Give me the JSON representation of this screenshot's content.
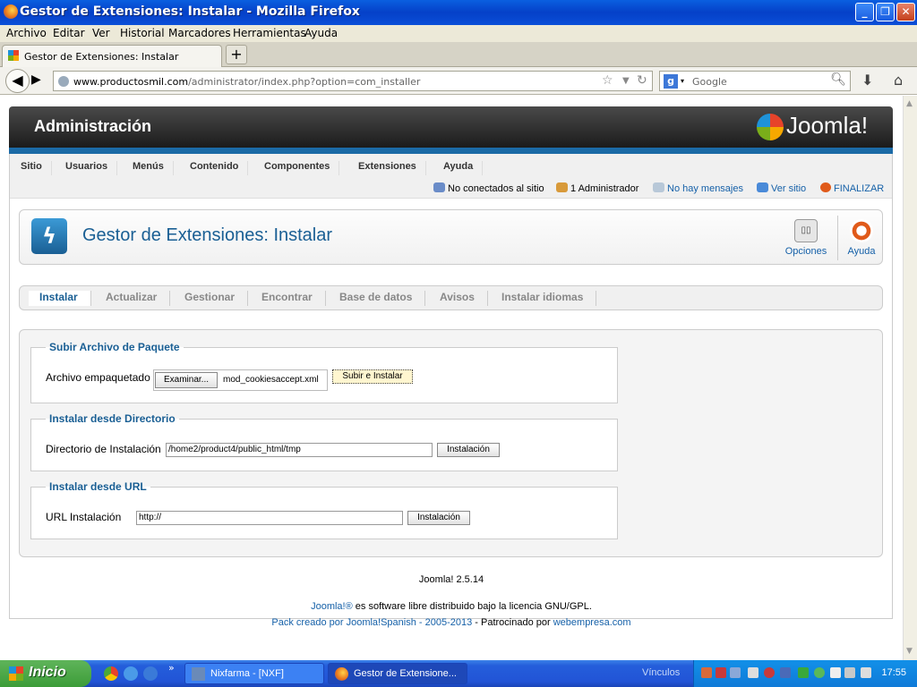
{
  "window": {
    "title": "Gestor de Extensiones: Instalar - Mozilla Firefox"
  },
  "menubar": [
    "Archivo",
    "Editar",
    "Ver",
    "Historial",
    "Marcadores",
    "Herramientas",
    "Ayuda"
  ],
  "tab": {
    "label": "Gestor de Extensiones: Instalar",
    "new_tab": "+"
  },
  "navbar": {
    "url_domain": "www.productosmil.com",
    "url_path": "/administrator/index.php?option=com_installer",
    "search_engine_letter": "g",
    "search_placeholder": "Google"
  },
  "joomla": {
    "header_title": "Administración",
    "logo_text": "Joomla!",
    "menu": [
      "Sitio",
      "Usuarios",
      "Menús",
      "Contenido",
      "Componentes",
      "Extensiones",
      "Ayuda"
    ],
    "status": {
      "offline": "No conectados al sitio",
      "admins": "1 Administrador",
      "messages": "No hay mensajes",
      "view_site": "Ver sitio",
      "logout": "FINALIZAR"
    },
    "page_title": "Gestor de Extensiones: Instalar",
    "toolbar": {
      "options": "Opciones",
      "options_icon_text": "▯▯",
      "help": "Ayuda"
    },
    "subnav": [
      "Instalar",
      "Actualizar",
      "Gestionar",
      "Encontrar",
      "Base de datos",
      "Avisos",
      "Instalar idiomas"
    ],
    "upload": {
      "legend": "Subir Archivo de Paquete",
      "label": "Archivo empaquetado",
      "browse": "Examinar...",
      "file": "mod_cookiesaccept.xml",
      "submit": "Subir e Instalar"
    },
    "directory": {
      "legend": "Instalar desde Directorio",
      "label": "Directorio de Instalación",
      "value": "/home2/product4/public_html/tmp",
      "button": "Instalación"
    },
    "url": {
      "legend": "Instalar desde URL",
      "label": "URL Instalación",
      "value": "http://",
      "button": "Instalación"
    },
    "version": "Joomla! 2.5.14",
    "license_link": "Joomla!®",
    "license_text": " es software libre distribuido bajo la licencia GNU/GPL.",
    "pack_text": "Pack creado por Joomla!Spanish - 2005-2013",
    "sponsor_text": " - Patrocinado por ",
    "sponsor_link": "webempresa.com"
  },
  "taskbar": {
    "start": "Inicio",
    "windows": [
      "Nixfarma - [NXF]",
      "Gestor de Extensione..."
    ],
    "links": "Vínculos",
    "clock": "17:55"
  }
}
